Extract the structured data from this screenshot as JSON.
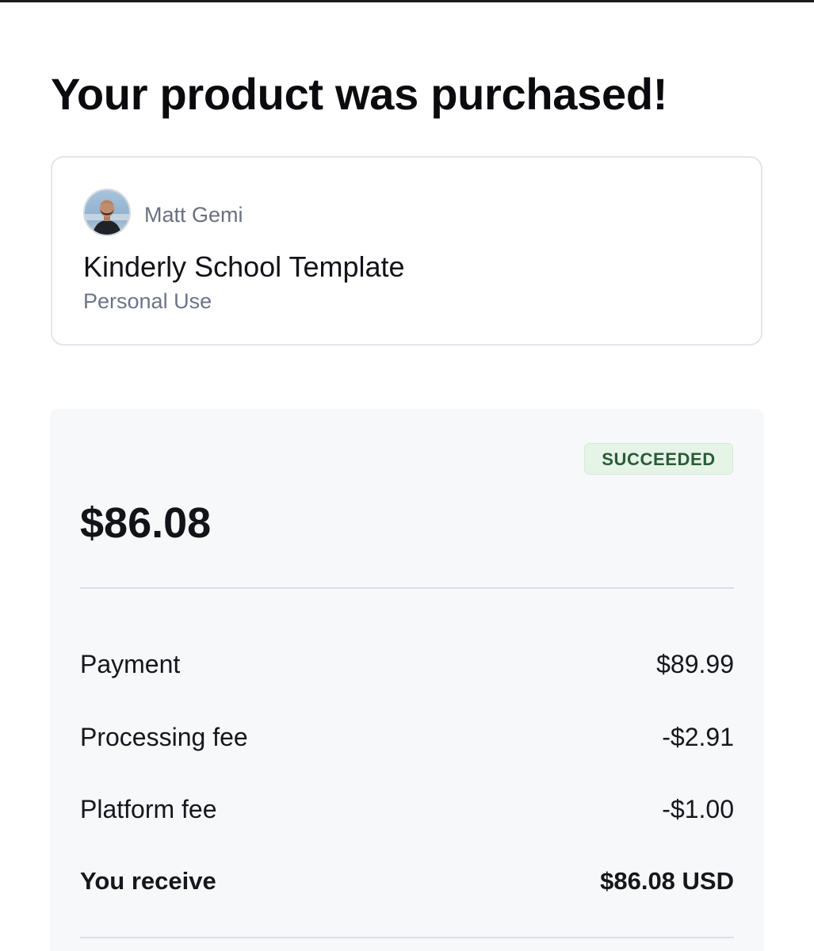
{
  "headline": "Your product was purchased!",
  "product": {
    "seller_name": "Matt Gemi",
    "avatar_icon": "user-avatar-photo",
    "name": "Kinderly School Template",
    "license": "Personal Use"
  },
  "summary": {
    "status": "SUCCEEDED",
    "status_color": "#2a5c37",
    "status_bg": "#e6f4e8",
    "amount": "$86.08",
    "rows": [
      {
        "label": "Payment",
        "value": "$89.99"
      },
      {
        "label": "Processing fee",
        "value": "-$2.91"
      },
      {
        "label": "Platform fee",
        "value": "-$1.00"
      }
    ],
    "total": {
      "label": "You receive",
      "value": "$86.08 USD"
    }
  }
}
